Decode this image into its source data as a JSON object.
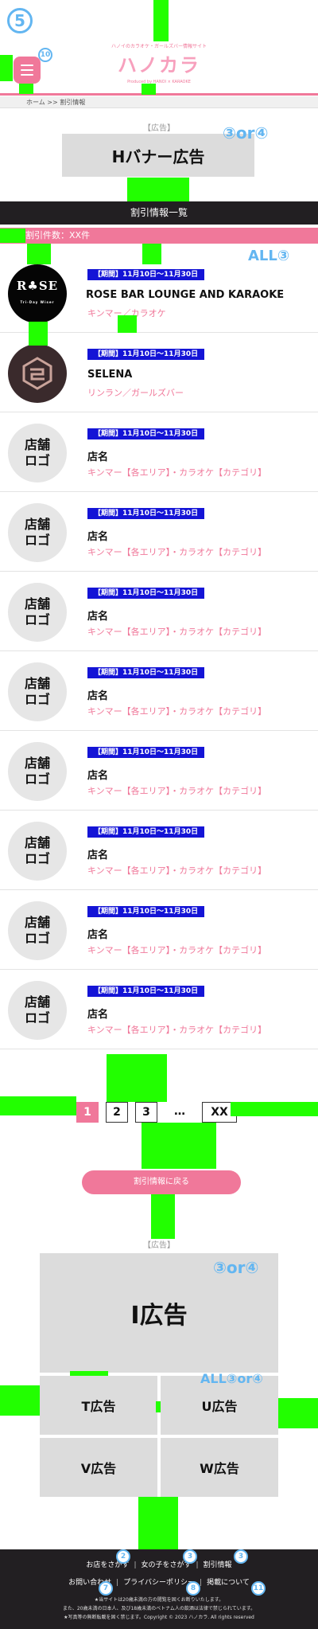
{
  "header": {
    "tagline": "ハノイのカラオケ・ガールズバー情報サイト",
    "logo": "ハノカラ",
    "produced_by": "Produced by HANOI × KARAOKE"
  },
  "breadcrumb": "ホーム >> 割引情報",
  "annotations": {
    "top_left": "5",
    "menu_badge": "10",
    "banner_mark": "③or④",
    "list_mark": "ALL③",
    "iad_mark": "③or④",
    "small_mark": "ALL③or④",
    "footer_badges": [
      "2",
      "3",
      "3",
      "7",
      "8",
      "11"
    ]
  },
  "banner": {
    "ad_tag": "【広告】",
    "label": "Hバナー広告"
  },
  "section_title": "割引情報一覧",
  "count_text": "割引件数：XX件",
  "items": [
    {
      "period": "【期間】11月10日〜11月30日",
      "name": "ROSE BAR LOUNGE AND KARAOKE",
      "category": "キンマー／カラオケ",
      "logo_type": "rose",
      "logo_title": "R♣SE",
      "logo_sub": "Tri-Day Wiser"
    },
    {
      "period": "【期間】11月10日〜11月30日",
      "name": "SELENA",
      "category": "リンラン／ガールズバー",
      "logo_type": "selena",
      "logo_title": "SELENA"
    },
    {
      "period": "【期間】11月10日〜11月30日",
      "name": "店名",
      "category": "キンマー【各エリア】・カラオケ【カテゴリ】",
      "logo_type": "placeholder",
      "logo_title": "店舗ロゴ"
    },
    {
      "period": "【期間】11月10日〜11月30日",
      "name": "店名",
      "category": "キンマー【各エリア】・カラオケ【カテゴリ】",
      "logo_type": "placeholder",
      "logo_title": "店舗ロゴ"
    },
    {
      "period": "【期間】11月10日〜11月30日",
      "name": "店名",
      "category": "キンマー【各エリア】・カラオケ【カテゴリ】",
      "logo_type": "placeholder",
      "logo_title": "店舗ロゴ"
    },
    {
      "period": "【期間】11月10日〜11月30日",
      "name": "店名",
      "category": "キンマー【各エリア】・カラオケ【カテゴリ】",
      "logo_type": "placeholder",
      "logo_title": "店舗ロゴ"
    },
    {
      "period": "【期間】11月10日〜11月30日",
      "name": "店名",
      "category": "キンマー【各エリア】・カラオケ【カテゴリ】",
      "logo_type": "placeholder",
      "logo_title": "店舗ロゴ"
    },
    {
      "period": "【期間】11月10日〜11月30日",
      "name": "店名",
      "category": "キンマー【各エリア】・カラオケ【カテゴリ】",
      "logo_type": "placeholder",
      "logo_title": "店舗ロゴ"
    },
    {
      "period": "【期間】11月10日〜11月30日",
      "name": "店名",
      "category": "キンマー【各エリア】・カラオケ【カテゴリ】",
      "logo_type": "placeholder",
      "logo_title": "店舗ロゴ"
    },
    {
      "period": "【期間】11月10日〜11月30日",
      "name": "店名",
      "category": "キンマー【各エリア】・カラオケ【カテゴリ】",
      "logo_type": "placeholder",
      "logo_title": "店舗ロゴ"
    }
  ],
  "pagination": {
    "pages": [
      "1",
      "2",
      "3",
      "…",
      "XX"
    ],
    "current": "1"
  },
  "back_button": "割引情報に戻る",
  "bottom_ads": {
    "ad_tag": "【広告】",
    "main": "I広告",
    "small": [
      "T広告",
      "U広告",
      "V広告",
      "W広告"
    ]
  },
  "footer": {
    "links_row1": [
      "お店をさがす",
      "女の子をさがす",
      "割引情報"
    ],
    "links_row2": [
      "お問い合わせ",
      "プライバシーポリシー",
      "掲載について"
    ],
    "notice1": "★当サイトは20歳未満の方の閲覧を固くお断りいたします。",
    "notice2": "また、20歳未満の日本人、及び18歳未満のベトナム人の飲酒は法律で禁じられています。",
    "copyright": "★写真等の無断転載を固く禁じます。Copyright © 2023 ハノカラ. All rights reserved"
  },
  "colors": {
    "brand_pink": "#f0789a",
    "dark": "#221f22",
    "period_blue": "#1414d6",
    "annotation_green": "#22ff00",
    "annotation_blue": "#63b6f1"
  }
}
